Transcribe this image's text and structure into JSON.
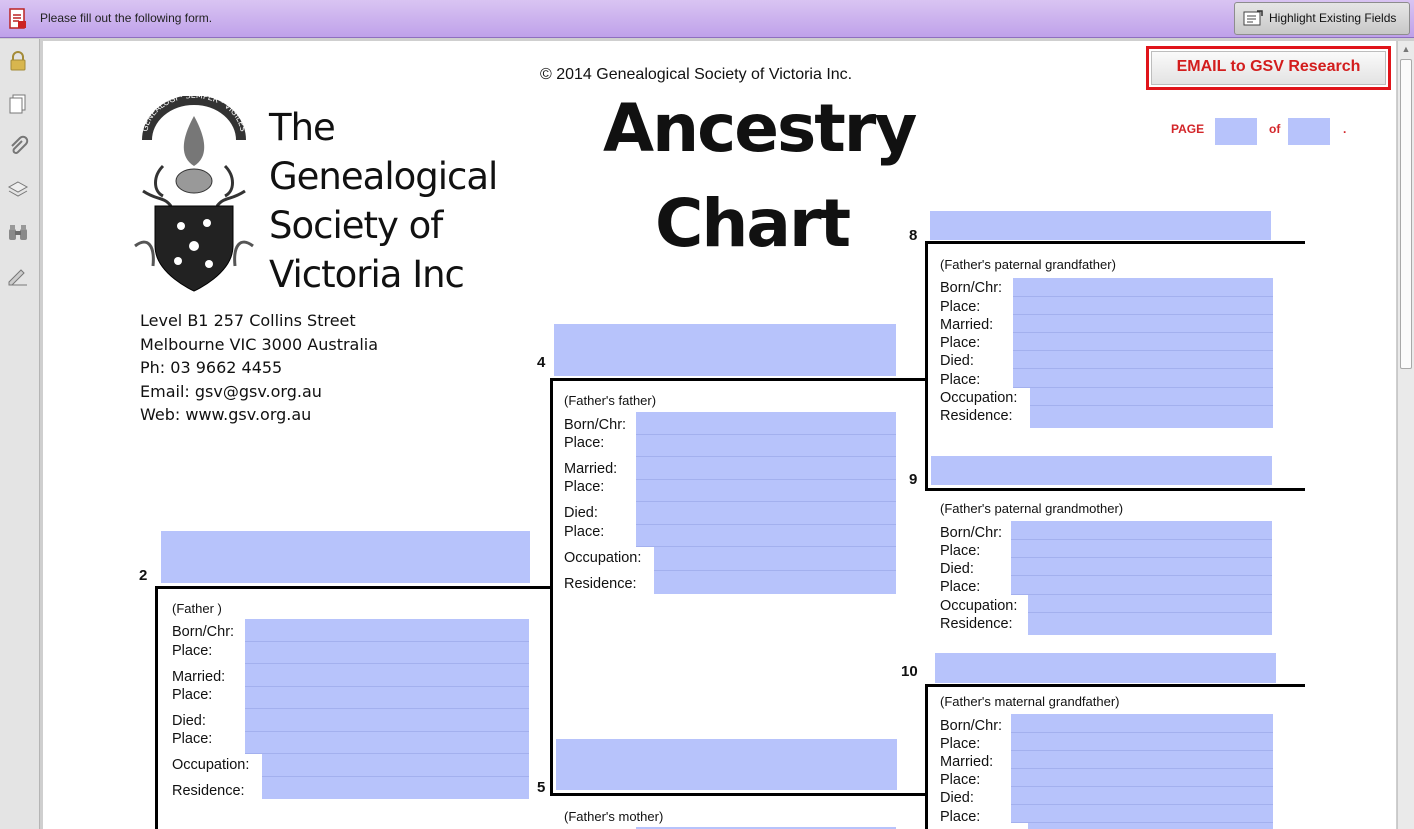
{
  "toolbar": {
    "message": "Please fill out the following form.",
    "highlight_button": "Highlight Existing Fields"
  },
  "sidebar": {
    "icons": [
      "lock-icon",
      "pages-icon",
      "attachment-icon",
      "layers-icon",
      "binoculars-icon",
      "signature-icon"
    ]
  },
  "document": {
    "copyright": "© 2014 Genealogical Society of Victoria Inc.",
    "email_button": "EMAIL to GSV Research",
    "title_line1": "Ancestry",
    "title_line2": "Chart",
    "org_name": [
      "The",
      "Genealogical",
      "Society of",
      "Victoria Inc"
    ],
    "address": [
      "Level B1  257 Collins Street",
      "Melbourne VIC 3000 Australia",
      "Ph: 03 9662 4455",
      "Email: gsv@gsv.org.au",
      "Web: www.gsv.org.au"
    ],
    "page_label": "PAGE",
    "of_label": "of",
    "period": ".",
    "seal_text": "GENEALOGI · SEMPER · VIGILES"
  },
  "persons": {
    "p2": {
      "number": "2",
      "relation": "(Father )"
    },
    "p4": {
      "number": "4",
      "relation": "(Father's father)"
    },
    "p5": {
      "number": "5",
      "relation": "(Father's mother)"
    },
    "p8": {
      "number": "8",
      "relation": "(Father's paternal grandfather)"
    },
    "p9": {
      "number": "9",
      "relation": "(Father's paternal grandmother)"
    },
    "p10": {
      "number": "10",
      "relation": "(Father's maternal grandfather)"
    }
  },
  "labels": {
    "born": "Born/Chr:",
    "place": "Place:",
    "married": "Married:",
    "died": "Died:",
    "occupation": "Occupation:",
    "residence": "Residence:"
  },
  "colors": {
    "field": "#b7c3fb",
    "accent_red": "#e0141a",
    "toolbar": "#c8aef0"
  }
}
